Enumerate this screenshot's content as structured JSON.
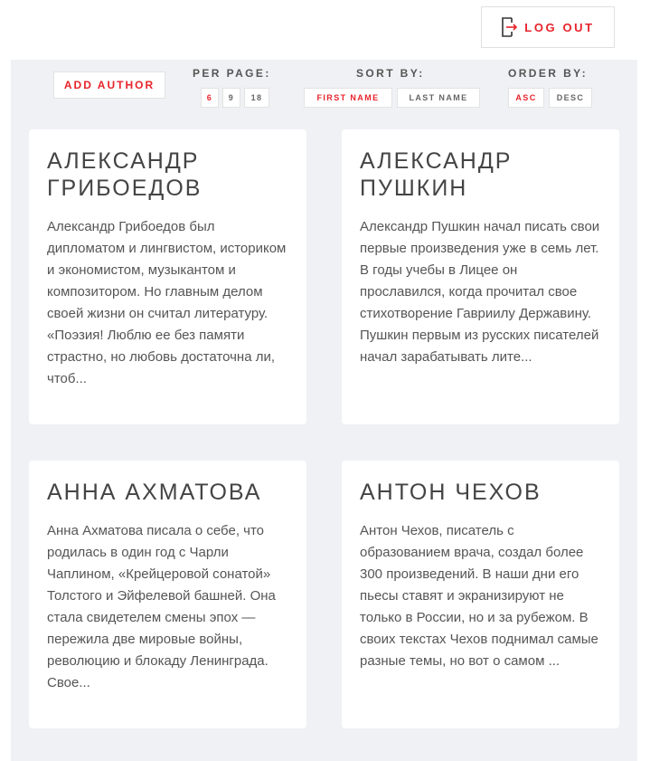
{
  "header": {
    "logout_label": "LOG OUT",
    "logout_icon": "log-out-icon"
  },
  "controls": {
    "add_author_label": "ADD AUTHOR",
    "per_page": {
      "label": "PER PAGE:",
      "options": [
        "6",
        "9",
        "18"
      ],
      "selected": "6"
    },
    "sort_by": {
      "label": "SORT BY:",
      "options": [
        "FIRST NAME",
        "LAST NAME"
      ],
      "selected": "FIRST NAME"
    },
    "order_by": {
      "label": "ORDER BY:",
      "options": [
        "ASC",
        "DESC"
      ],
      "selected": "ASC"
    }
  },
  "authors": [
    {
      "name": "Александр Грибоедов",
      "excerpt": "Александр Грибоедов был дипломатом и лингвистом, историком и экономистом, музыкантом и композитором. Но главным делом своей жизни он считал литературу. «Поэзия! Люблю ее без памяти страстно, но любовь достаточна ли, чтоб..."
    },
    {
      "name": "Александр Пушкин",
      "excerpt": "Александр Пушкин начал писать свои первые произведения уже в семь лет. В годы учебы в Лицее он прославился, когда прочитал свое стихотворение Гавриилу Державину. Пушкин первым из русских писателей начал зарабатывать лите..."
    },
    {
      "name": "Анна Ахматова",
      "excerpt": "Анна Ахматова писала о себе, что родилась в один год с Чарли Чаплином, «Крейцеровой сонатой» Толстого и Эйфелевой башней. Она стала свидетелем смены эпох — пережила две мировые войны, революцию и блокаду Ленинграда. Свое..."
    },
    {
      "name": "Антон Чехов",
      "excerpt": "Антон Чехов, писатель с образованием врача, создал более 300 произведений. В наши дни его пьесы ставят и экранизируют не только в России, но и за рубежом. В своих текстах Чехов поднимал самые разные темы, но вот о самом ..."
    }
  ],
  "colors": {
    "accent": "#e8232b",
    "panel_bg": "#eff1f4",
    "card_bg": "#ffffff",
    "text": "#555555",
    "heading": "#444444"
  }
}
